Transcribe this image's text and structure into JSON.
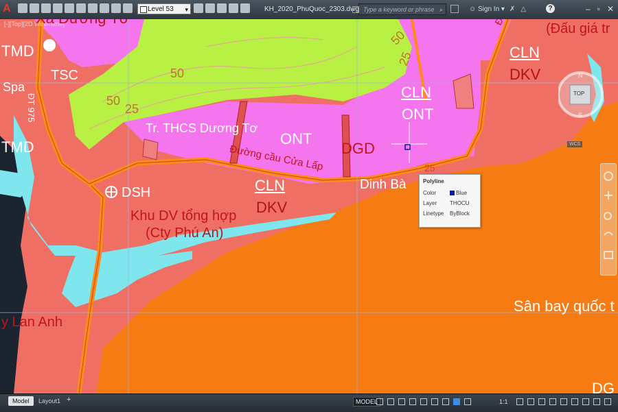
{
  "window": {
    "app_icon": "A",
    "document_title": "KH_2020_PhuQuoc_2303.dwg",
    "layer_dropdown_value": "Level 53",
    "search_placeholder": "Type a keyword or phrase",
    "sign_in_label": "Sign In",
    "help_label": "?"
  },
  "viewport": {
    "label": "[-][Top][2D Wireframe]"
  },
  "map_labels": {
    "xa_duong_to": "Xã Dương Tơ",
    "dau_gia": "(Đấu giá tr",
    "tmd_1": "TMD",
    "tsc": "TSC",
    "spa": "Spa",
    "road_975": "ĐT 975",
    "tmd_2": "TMD",
    "cln_1": "CLN",
    "ont_1": "ONT",
    "cln_2": "CLN",
    "dkv_1": "DKV",
    "school": "Tr. THCS Dương Tơ",
    "ont_2": "ONT",
    "bridge_road": "Đường cầu Cửa Lấp",
    "dgd": "DGD",
    "dinh_ba": "Dinh Bà",
    "dsh": "DSH",
    "cln_3": "CLN",
    "dkv_2": "DKV",
    "khu_dv": "Khu DV tổng hợp",
    "cty": "(Cty Phú An)",
    "lan_anh": "y Lan Anh",
    "airport": "Sân bay quốc t",
    "dg": "DG",
    "contour_50a": "50",
    "contour_50b": "50",
    "contour_25a": "25",
    "contour_25b": "25",
    "contour_50c": "50",
    "contour_25c": "25",
    "duong": "Đư"
  },
  "tooltip": {
    "title": "Polyline",
    "rows": [
      {
        "key": "Color",
        "value": "Blue"
      },
      {
        "key": "Layer",
        "value": "THOCU"
      },
      {
        "key": "Linetype",
        "value": "ByBlock"
      }
    ]
  },
  "viewcube": {
    "top": "TOP",
    "n": "N",
    "s": "S",
    "wcs": "WCS"
  },
  "status": {
    "tabs": [
      "Model",
      "Layout1"
    ],
    "model_label": "MODEL",
    "scale": "1:1"
  },
  "colors": {
    "pink_land": "#ef6f65",
    "magenta_residential": "#f575ee",
    "green_forest": "#b8f043",
    "orange_airport": "#f57b12",
    "cyan_water": "#7fe6ee",
    "road_orange": "#ff8a1c"
  }
}
